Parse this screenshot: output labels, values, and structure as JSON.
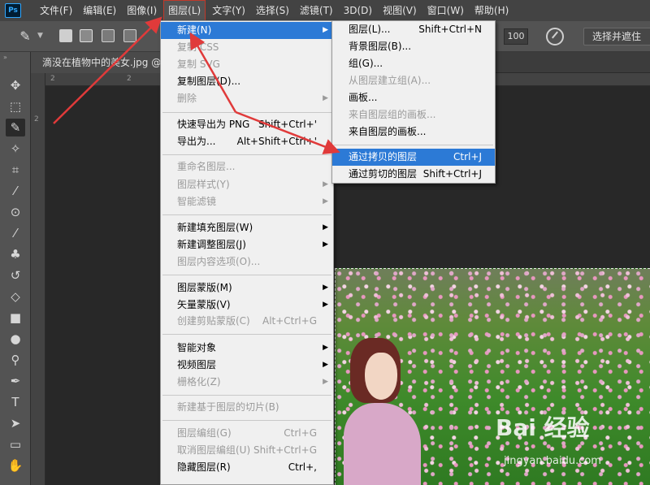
{
  "menubar": {
    "logo": "Ps",
    "items": [
      "文件(F)",
      "编辑(E)",
      "图像(I)",
      "图层(L)",
      "文字(Y)",
      "选择(S)",
      "滤镜(T)",
      "3D(D)",
      "视图(V)",
      "窗口(W)",
      "帮助(H)"
    ]
  },
  "options": {
    "value": "100",
    "select_mask": "选择并遮住"
  },
  "document": {
    "tab_title": "滴没在植物中的美女.jpg @"
  },
  "rulers": {
    "top": [
      "2",
      "2"
    ],
    "left": [
      "2"
    ]
  },
  "layer_menu": {
    "new": "新建(N)",
    "copy_css": "复制 CSS",
    "copy_svg": "复制 SVG",
    "duplicate": "复制图层(D)...",
    "delete": "删除",
    "quick_export": "快速导出为 PNG",
    "quick_export_sc": "Shift+Ctrl+'",
    "export_as": "导出为...",
    "export_as_sc": "Alt+Shift+Ctrl+'",
    "rename": "重命名图层...",
    "layer_style": "图层样式(Y)",
    "smart_filter": "智能滤镜",
    "new_fill": "新建填充图层(W)",
    "new_adjust": "新建调整图层(J)",
    "content_options": "图层内容选项(O)...",
    "layer_mask": "图层蒙版(M)",
    "vector_mask": "矢量蒙版(V)",
    "clipping_mask": "创建剪贴蒙版(C)",
    "clipping_mask_sc": "Alt+Ctrl+G",
    "smart_object": "智能对象",
    "video_layer": "视频图层",
    "rasterize": "栅格化(Z)",
    "new_slice": "新建基于图层的切片(B)",
    "group": "图层编组(G)",
    "group_sc": "Ctrl+G",
    "ungroup": "取消图层编组(U)",
    "ungroup_sc": "Shift+Ctrl+G",
    "hide": "隐藏图层(R)",
    "hide_sc": "Ctrl+,"
  },
  "new_submenu": {
    "layer": "图层(L)...",
    "layer_sc": "Shift+Ctrl+N",
    "background": "背景图层(B)...",
    "group": "组(G)...",
    "group_from_layers": "从图层建立组(A)...",
    "artboard": "画板...",
    "artboard_from_group": "来自图层组的画板...",
    "artboard_from_layers": "来自图层的画板...",
    "via_copy": "通过拷贝的图层",
    "via_copy_sc": "Ctrl+J",
    "via_cut": "通过剪切的图层",
    "via_cut_sc": "Shift+Ctrl+J"
  },
  "watermark": {
    "logo": "Bai 经验",
    "url": "jingyan.baidu.com"
  },
  "colors": {
    "menubar": "#434343",
    "highlight": "#2c7ad6",
    "annotation": "#e03a3a"
  }
}
